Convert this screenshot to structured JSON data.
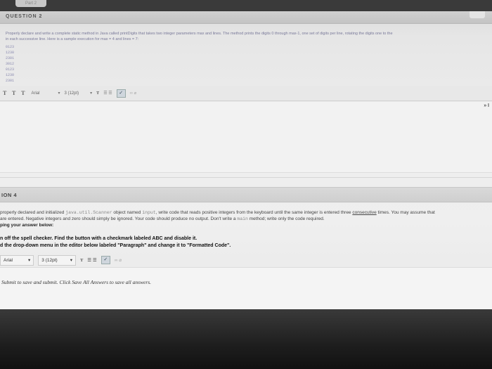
{
  "top": {
    "tab_label": "Part 2"
  },
  "question1": {
    "header": "QUESTION 2",
    "line1": "Properly declare and write a complete static method in Java called printDigits that takes two integer parameters max and lines. The method prints the digits 0 through max-1, one set of digits per line, rotating the digits one to the",
    "line2": "in each successive line. Here is a sample execution for max = 4 and lines = 7:",
    "sample": [
      "0123",
      "1230",
      "2301",
      "3012",
      "0123",
      "1230",
      "2301"
    ]
  },
  "toolbar1": {
    "format_buttons": "T T T",
    "font": "Arial",
    "size": "3 (12pt)",
    "text_color_icon": "T",
    "list_icons": "☰ ☰"
  },
  "editor1": {
    "corner": "» I"
  },
  "question2": {
    "header": "ION 4",
    "line1_a": "properly declared and initialized ",
    "line1_mono": "java.util.Scanner",
    "line1_b": " object named ",
    "line1_mono2": "input",
    "line1_c": ", write code that reads positive integers from the keyboard until the same integer is entered three ",
    "line1_link": "consecutive",
    "line1_d": " times. You may assume that",
    "line2_a": "are entered. Negative integers and zero should simply be ignored. Your code should produce no output. Don't write a ",
    "line2_mono": "main",
    "line2_b": " method; write only the code required.",
    "line3": "ping your answer below:",
    "instr1": "n off the spell checker. Find the button with a checkmark labeled ABC and disable it.",
    "instr2": "d the drop-down menu in the editor below labeled \"Paragraph\" and change it to \"Formatted Code\"."
  },
  "toolbar2": {
    "font": "Arial",
    "size": "3 (12pt)",
    "text_color_icon": "T",
    "list_icons": "☰ ☰"
  },
  "footer": {
    "submit_hint": "Submit to save and submit. Click Save All Answers to save all answers."
  }
}
